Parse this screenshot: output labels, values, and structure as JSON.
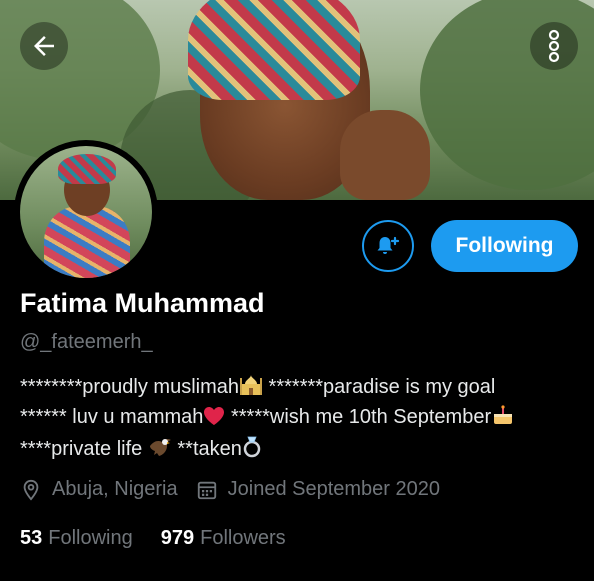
{
  "profile": {
    "name": "Fatima Muhammad",
    "handle": "@_fateemerh_",
    "bio": {
      "line1a": "********proudly muslimah",
      "line1b": " *******paradise is my goal",
      "line2a": "****** luv u mammah",
      "line2b": " *****wish me 10th September",
      "line3a": "****private life ",
      "line3b": " **taken"
    },
    "location": "Abuja, Nigeria",
    "joined": "Joined September 2020"
  },
  "stats": {
    "following_count": "53",
    "following_label": "Following",
    "followers_count": "979",
    "followers_label": "Followers"
  },
  "actions": {
    "follow_button_label": "Following"
  },
  "icons": {
    "back": "arrow-left-icon",
    "more": "more-vertical-icon",
    "bell": "bell-plus-icon",
    "location": "location-pin-icon",
    "calendar": "calendar-icon"
  },
  "colors": {
    "accent": "#1d9bf0",
    "background": "#000000",
    "secondary_text": "#71767b"
  }
}
